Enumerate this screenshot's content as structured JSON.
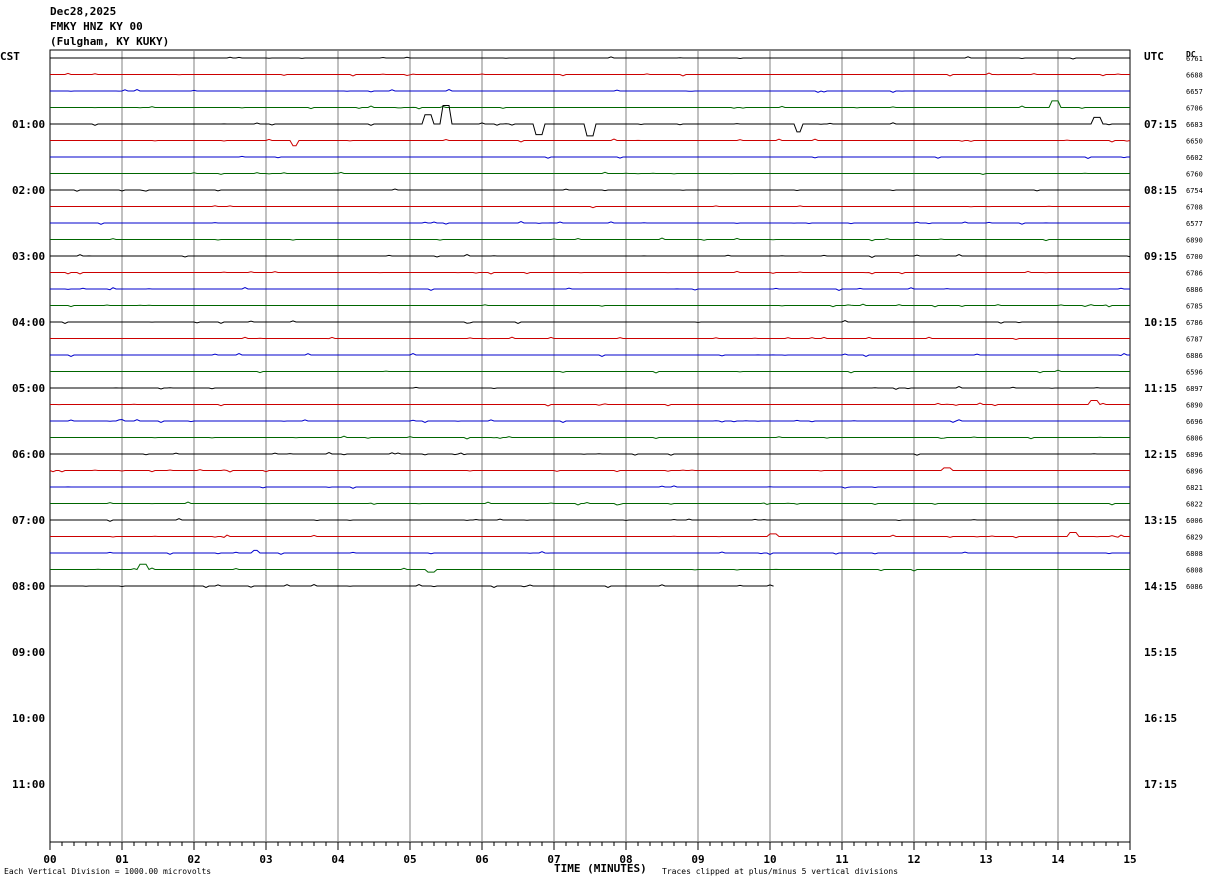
{
  "header": {
    "date": "Dec28,2025",
    "station": "FMKY HNZ KY 00",
    "location": "(Fulgham, KY KUKY)"
  },
  "labels": {
    "left_zone": "CST",
    "right_zone": "UTC",
    "dc_label": "DC",
    "x_axis_title": "TIME (MINUTES)",
    "scale_note": "Each Vertical Division = 1000.00 microvolts",
    "clip_note": "Traces clipped at plus/minus 5 vertical divisions"
  },
  "colors": {
    "trace_cycle": [
      "#000000",
      "#cc0000",
      "#0000cc",
      "#006600"
    ],
    "grid": "#808080"
  },
  "chart_data": {
    "type": "line",
    "title": "FMKY HNZ KY 00",
    "xlabel": "TIME (MINUTES)",
    "ylabel": "",
    "xlim": [
      0,
      15
    ],
    "x_ticks": [
      "00",
      "01",
      "02",
      "03",
      "04",
      "05",
      "06",
      "07",
      "08",
      "09",
      "10",
      "11",
      "12",
      "13",
      "14",
      "15"
    ],
    "rows_per_hour": 4,
    "row_minutes": 15,
    "left_hours": [
      "01:00",
      "02:00",
      "03:00",
      "04:00",
      "05:00",
      "06:00",
      "07:00",
      "08:00",
      "09:00",
      "10:00",
      "11:00"
    ],
    "right_hours": [
      "07:15",
      "08:15",
      "09:15",
      "10:15",
      "11:15",
      "12:15",
      "13:15",
      "14:15",
      "15:15",
      "16:15",
      "17:15"
    ],
    "dc_offsets": [
      "6761",
      "6688",
      "6657",
      "6706",
      "6683",
      "6650",
      "6602",
      "6760",
      "6754",
      "6708",
      "6577",
      "6890",
      "6700",
      "6786",
      "6886",
      "6785",
      "6786",
      "6787",
      "6886",
      "6596",
      "6897",
      "6890",
      "6696",
      "6806",
      "6896",
      "6896",
      "6821",
      "6822",
      "6006",
      "6829",
      "6808",
      "6808",
      "6086"
    ],
    "last_trace_end_minute": 10.05,
    "events": [
      {
        "row": 3,
        "minute": 13.95,
        "amp": 0.5
      },
      {
        "row": 4,
        "minute": 5.25,
        "amp": 0.7
      },
      {
        "row": 4,
        "minute": 5.5,
        "amp": 1.4
      },
      {
        "row": 4,
        "minute": 6.8,
        "amp": -0.8
      },
      {
        "row": 4,
        "minute": 7.5,
        "amp": -0.9
      },
      {
        "row": 4,
        "minute": 10.4,
        "amp": -0.6
      },
      {
        "row": 4,
        "minute": 14.55,
        "amp": 0.5
      },
      {
        "row": 5,
        "minute": 3.4,
        "amp": -0.4
      },
      {
        "row": 21,
        "minute": 14.5,
        "amp": 0.3
      },
      {
        "row": 25,
        "minute": 12.45,
        "amp": 0.2
      },
      {
        "row": 29,
        "minute": 10.05,
        "amp": 0.2
      },
      {
        "row": 29,
        "minute": 14.2,
        "amp": 0.3
      },
      {
        "row": 30,
        "minute": 2.85,
        "amp": 0.2
      },
      {
        "row": 31,
        "minute": 1.3,
        "amp": 0.4
      },
      {
        "row": 31,
        "minute": 5.3,
        "amp": -0.2
      }
    ]
  }
}
